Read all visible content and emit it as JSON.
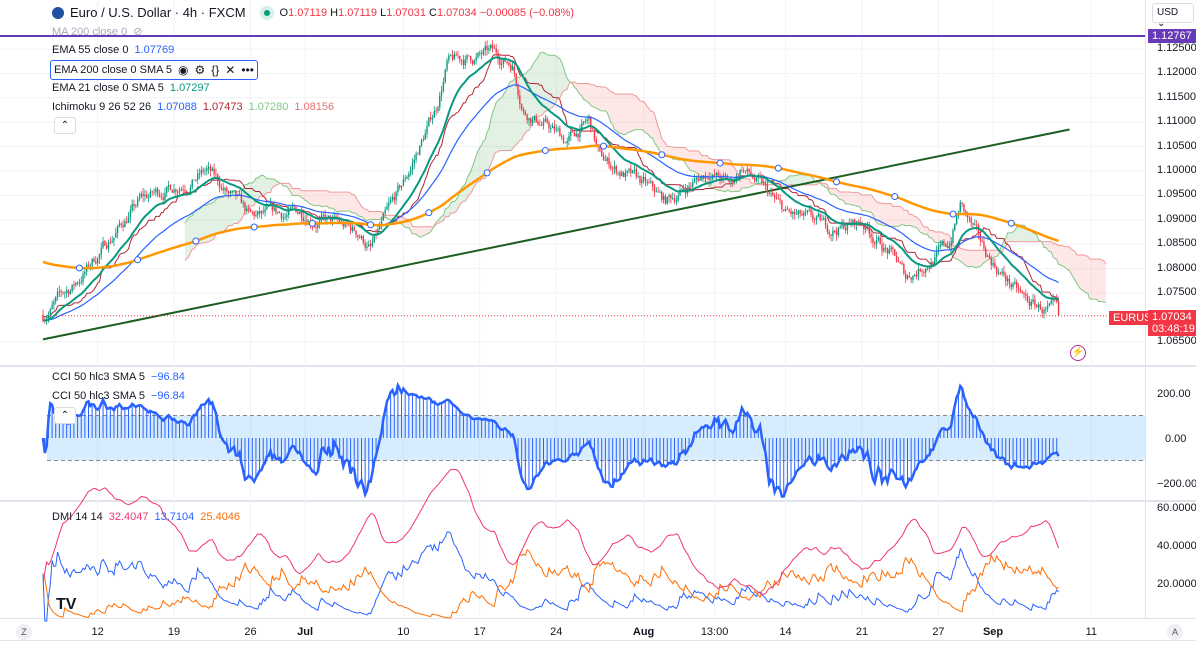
{
  "header": {
    "symbol": "Euro / U.S. Dollar · 4h · FXCM",
    "ohlc": [
      {
        "k": "O",
        "v": "1.07119"
      },
      {
        "k": "H",
        "v": "1.07119"
      },
      {
        "k": "L",
        "v": "1.07031"
      },
      {
        "k": "C",
        "v": "1.07034"
      }
    ],
    "change": "−0.00085 (−0.08%)"
  },
  "indicators": {
    "ma200": {
      "label": "MA 200 close 0"
    },
    "ema55": {
      "label": "EMA 55 close 0",
      "value": "1.07769"
    },
    "ema200": {
      "label": "EMA 200 close 0 SMA 5"
    },
    "ema21": {
      "label": "EMA 21 close 0 SMA 5",
      "value": "1.07297"
    },
    "ichimoku": {
      "label": "Ichimoku 9 26 52 26",
      "values": [
        "1.07088",
        "1.07473",
        "1.07280",
        "1.08156"
      ]
    },
    "cci": {
      "label": "CCI 50 hlc3 SMA 5",
      "value": "−96.84"
    },
    "dmi": {
      "label": "DMI 14 14",
      "values": [
        "32.4047",
        "13.7104",
        "25.4046"
      ]
    }
  },
  "price_axis": {
    "currency": "USD",
    "ticks": [
      "1.12500",
      "1.12000",
      "1.11500",
      "1.11000",
      "1.10500",
      "1.10000",
      "1.09500",
      "1.09000",
      "1.08500",
      "1.08000",
      "1.07500",
      "1.06500"
    ],
    "hline": "1.12767",
    "symbol_tag": "EURUSD",
    "last": "1.07034",
    "countdown": "03:48:19"
  },
  "cci_axis": [
    "200.00",
    "0.00",
    "−200.00"
  ],
  "dmi_axis": [
    "60.0000",
    "40.0000",
    "20.0000"
  ],
  "time_axis": [
    {
      "t": "12",
      "d": 5
    },
    {
      "t": "19",
      "d": 12
    },
    {
      "t": "26",
      "d": 19
    },
    {
      "t": "Jul",
      "d": 24,
      "b": true
    },
    {
      "t": "10",
      "d": 33
    },
    {
      "t": "17",
      "d": 40
    },
    {
      "t": "24",
      "d": 47
    },
    {
      "t": "Aug",
      "d": 55,
      "b": true
    },
    {
      "t": "13:00",
      "d": 61.5
    },
    {
      "t": "14",
      "d": 68
    },
    {
      "t": "21",
      "d": 75
    },
    {
      "t": "27",
      "d": 82
    },
    {
      "t": "Sep",
      "d": 87,
      "b": true
    },
    {
      "t": "11",
      "d": 96
    }
  ],
  "colors": {
    "up": "#089981",
    "down": "#f23645",
    "ema21": "#089981",
    "ema55": "#2962ff",
    "ema200": "#ff9800",
    "trend": "#1b5e20",
    "hline": "#673ab7"
  },
  "chart_data": {
    "type": "candlestick",
    "symbol": "EURUSD",
    "interval": "4h",
    "keypoints_day_price": [
      [
        0,
        1.0705
      ],
      [
        3,
        1.077
      ],
      [
        8,
        1.0915
      ],
      [
        9,
        1.094
      ],
      [
        15,
        1.1
      ],
      [
        19,
        1.09
      ],
      [
        24,
        1.0915
      ],
      [
        29,
        1.087
      ],
      [
        30,
        1.084
      ],
      [
        33,
        1.097
      ],
      [
        36,
        1.113
      ],
      [
        37,
        1.122
      ],
      [
        41,
        1.124
      ],
      [
        43,
        1.122
      ],
      [
        44,
        1.113
      ],
      [
        48,
        1.106
      ],
      [
        50,
        1.11
      ],
      [
        51,
        1.1025
      ],
      [
        55,
        1.097
      ],
      [
        57,
        1.0935
      ],
      [
        61,
        1.1
      ],
      [
        63,
        1.097
      ],
      [
        64,
        1.101
      ],
      [
        68,
        1.091
      ],
      [
        72,
        1.088
      ],
      [
        75,
        1.0895
      ],
      [
        78,
        1.082
      ],
      [
        79,
        1.078
      ],
      [
        83,
        1.085
      ],
      [
        84,
        1.093
      ],
      [
        86,
        1.084
      ],
      [
        90,
        1.073
      ],
      [
        93,
        1.0703
      ]
    ],
    "trendline": [
      [
        0,
        1.0655
      ],
      [
        94,
        1.1085
      ]
    ]
  }
}
